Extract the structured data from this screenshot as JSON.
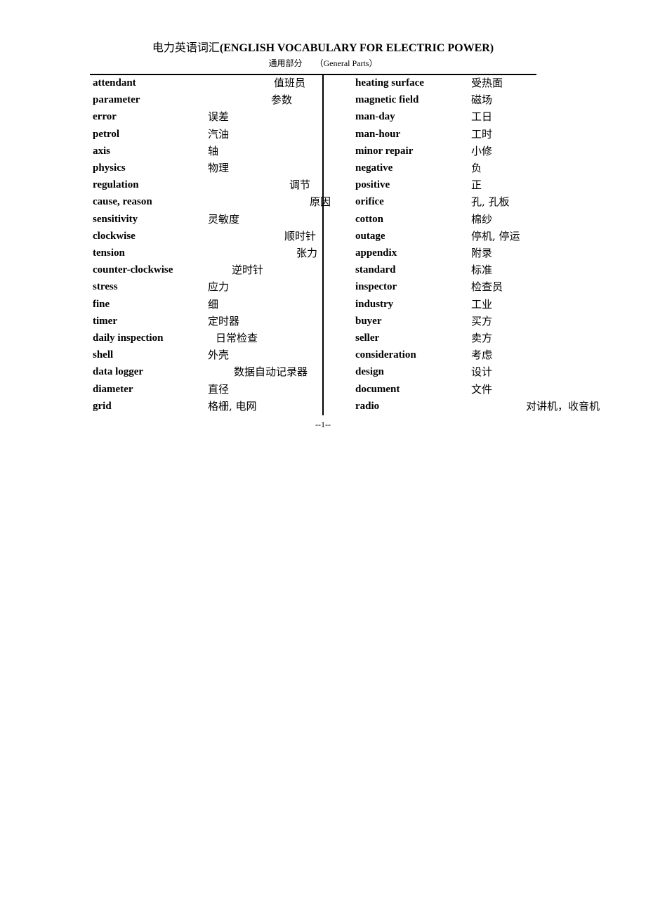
{
  "header": {
    "title_cn": "电力英语词汇",
    "title_en": "(ENGLISH VOCABULARY FOR ELECTRIC POWER)",
    "subtitle_cn": "通用部分",
    "subtitle_en": "（General Parts）"
  },
  "left_column": [
    {
      "term": "attendant",
      "translation": "值班员",
      "align": 390
    },
    {
      "term": "parameter",
      "translation": "参数",
      "align": 386
    },
    {
      "term": "error",
      "translation": "误差",
      "align": 296
    },
    {
      "term": "petrol",
      "translation": "汽油",
      "align": 296
    },
    {
      "term": "axis",
      "translation": "轴",
      "align": 296
    },
    {
      "term": "physics",
      "translation": "物理",
      "align": 296
    },
    {
      "term": "regulation",
      "translation": "调节",
      "align": 412
    },
    {
      "term": "cause, reason",
      "translation": "原因",
      "align": 441
    },
    {
      "term": "sensitivity",
      "translation": "灵敏度",
      "align": 296
    },
    {
      "term": "clockwise",
      "translation": "顺时针",
      "align": 405
    },
    {
      "term": "tension",
      "translation": "张力",
      "align": 422
    },
    {
      "term": "counter-clockwise",
      "translation": "逆时针",
      "align": 330
    },
    {
      "term": "stress",
      "translation": "应力",
      "align": 296
    },
    {
      "term": "fine",
      "translation": "细",
      "align": 296
    },
    {
      "term": "timer",
      "translation": "定时器",
      "align": 296
    },
    {
      "term": "daily inspection",
      "translation": "日常检查",
      "align": 307
    },
    {
      "term": "shell",
      "translation": "外壳",
      "align": 296
    },
    {
      "term": "data logger",
      "translation": "数据自动记录器",
      "align": 333
    },
    {
      "term": "diameter",
      "translation": "直径",
      "align": 296
    },
    {
      "term": "grid",
      "translation": "格栅, 电网",
      "align": 296
    }
  ],
  "right_column": [
    {
      "term": "heating surface",
      "translation": "受热面",
      "align": 671
    },
    {
      "term": "magnetic field",
      "translation": "磁场",
      "align": 671
    },
    {
      "term": "man-day",
      "translation": "工日",
      "align": 671
    },
    {
      "term": "man-hour",
      "translation": "工时",
      "align": 671
    },
    {
      "term": "minor repair",
      "translation": "小修",
      "align": 671
    },
    {
      "term": "negative",
      "translation": "负",
      "align": 671
    },
    {
      "term": "positive",
      "translation": "正",
      "align": 671
    },
    {
      "term": "orifice",
      "translation": "孔, 孔板",
      "align": 671
    },
    {
      "term": "cotton",
      "translation": "棉纱",
      "align": 671
    },
    {
      "term": "outage",
      "translation": "停机, 停运",
      "align": 671
    },
    {
      "term": "appendix",
      "translation": "附录",
      "align": 671
    },
    {
      "term": "standard",
      "translation": "标准",
      "align": 671
    },
    {
      "term": "inspector",
      "translation": "检查员",
      "align": 671
    },
    {
      "term": "industry",
      "translation": "工业",
      "align": 671
    },
    {
      "term": "buyer",
      "translation": "买方",
      "align": 671
    },
    {
      "term": "seller",
      "translation": "卖方",
      "align": 671
    },
    {
      "term": "consideration",
      "translation": "考虑",
      "align": 671
    },
    {
      "term": "design",
      "translation": "设计",
      "align": 671
    },
    {
      "term": "document",
      "translation": "文件",
      "align": 671
    },
    {
      "term": "radio",
      "translation": "对讲机，收音机",
      "align": 749
    }
  ],
  "footer": {
    "page_number": "--1--"
  }
}
